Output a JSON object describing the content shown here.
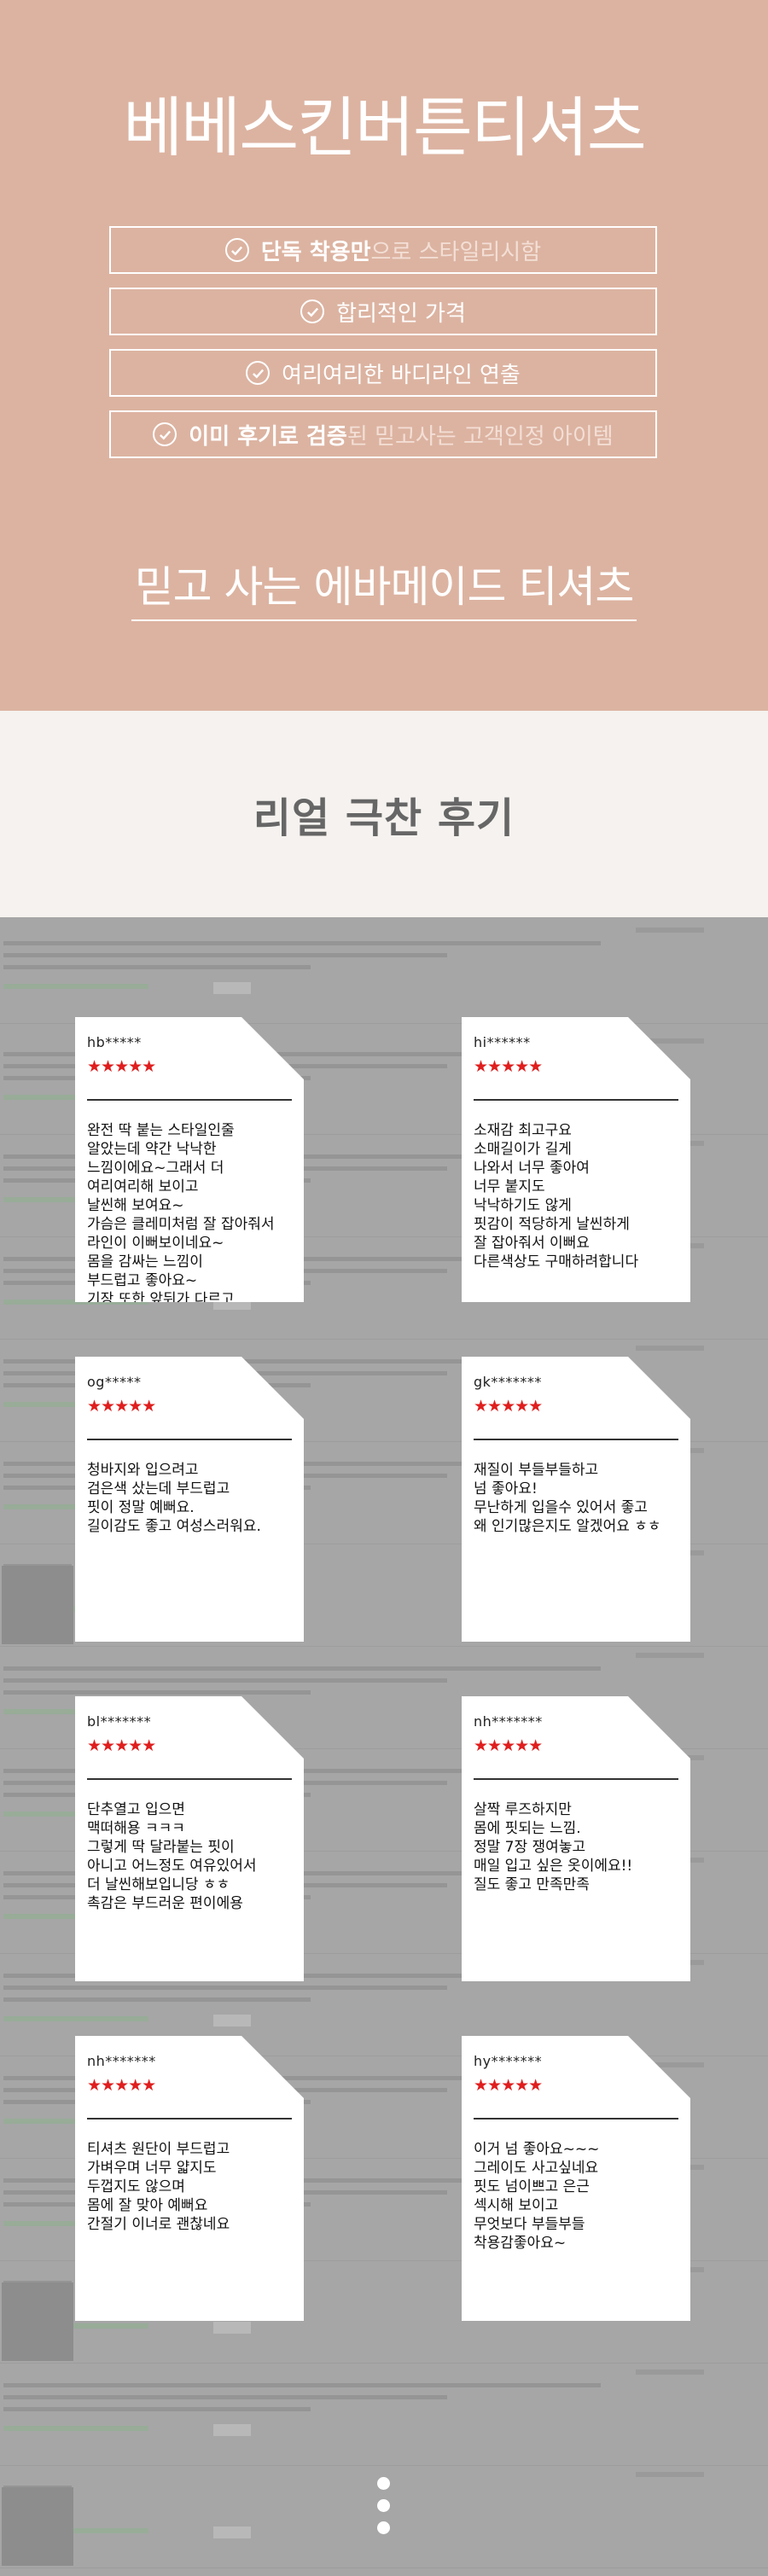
{
  "hero": {
    "title": "베베스킨버튼티셔츠",
    "features": [
      {
        "strong": "단독 착용만",
        "light": "으로 스타일리시함",
        "normal": ""
      },
      {
        "strong": "",
        "light": "",
        "normal": "합리적인 가격"
      },
      {
        "strong": "",
        "light": "",
        "normal": "여리여리한 바디라인 연출"
      },
      {
        "strong": "이미 후기로 검증",
        "light": " 된 믿고사는 고객인정 아이템",
        "normal": ""
      }
    ],
    "tagline": "믿고 사는 에바메이드 티셔츠"
  },
  "reviews_section": {
    "title": "리얼 극찬 후기",
    "cards": [
      {
        "user": "hb*****",
        "stars": "★★★★★",
        "text": "완전 딱 붙는 스타일인줄\n알았는데 약간 낙낙한\n느낌이에요~그래서 더\n여리여리해 보이고\n날씬해 보여요~\n가슴은 클레미처럼 잘 잡아줘서\n라인이 이뻐보이네요~\n몸을 감싸는 느낌이\n부드럽고 좋아요~\n기장 또한 앞뒤가 다르고\n뒤쪽이 엉덩이 라인까지\n내려와요~\n바지에 입어도 이뻐요~\n예쁘게 잘 입을께요^^♡"
      },
      {
        "user": "hi******",
        "stars": "★★★★★",
        "text": "소재감 최고구요\n소매길이가 길게\n나와서 너무 좋아여\n너무 붙지도\n낙낙하기도 않게\n핏감이 적당하게 날씬하게\n잘 잡아줘서 이뻐요\n다른색상도 구매하려합니다"
      },
      {
        "user": "og*****",
        "stars": "★★★★★",
        "text": "청바지와 입으려고\n검은색 샀는데 부드럽고\n핏이 정말 예뻐요.\n길이감도 좋고 여성스러워요."
      },
      {
        "user": "gk*******",
        "stars": "★★★★★",
        "text": "재질이 부들부들하고\n넘 좋아요!\n무난하게 입을수 있어서 좋고\n왜 인기많은지도 알겠어요 ㅎㅎ"
      },
      {
        "user": "bl*******",
        "stars": "★★★★★",
        "text": "단추열고 입으면\n맥떠해용 ㅋㅋㅋ\n그렇게 딱 달라붙는 핏이\n아니고 어느정도 여유있어서\n더 날씬해보입니당 ㅎㅎ\n촉감은 부드러운 편이에용"
      },
      {
        "user": "nh*******",
        "stars": "★★★★★",
        "text": "살짝 루즈하지만\n몸에 핏되는 느낌.\n정말 7장 쟁여놓고\n매일 입고 싶은 옷이에요!!\n질도 좋고 만족만족"
      },
      {
        "user": "nh*******",
        "stars": "★★★★★",
        "text": "티셔츠 원단이 부드럽고\n가벼우며 너무 얇지도\n두껍지도 않으며\n몸에 잘 맞아 예뻐요\n간절기 이너로 괜찮네요"
      },
      {
        "user": "hy*******",
        "stars": "★★★★★",
        "text": "이거 넘 좋아요~~~\n그레이도 사고싶네요\n핏도 넘이쁘고 은근\n섹시해 보이고\n무엇보다 부들부들\n착용감좋아요~"
      }
    ]
  },
  "colors": {
    "hero_bg": "#dcb3a1",
    "review_head_bg": "#f5f2ef",
    "board_bg": "#a6a6a6",
    "star": "#e01e1e"
  },
  "icons": {
    "feature_check": "check-circle-icon",
    "pagination": "dot-icon"
  }
}
